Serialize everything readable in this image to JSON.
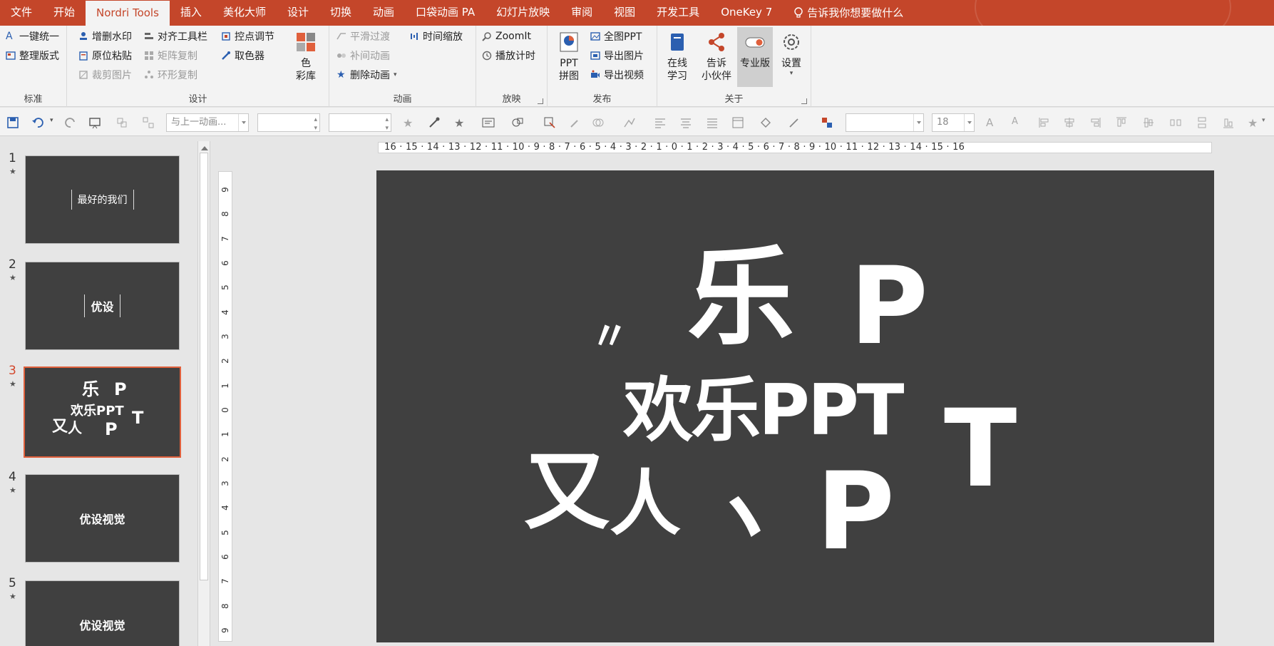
{
  "tabs": [
    "文件",
    "开始",
    "Nordri Tools",
    "插入",
    "美化大师",
    "设计",
    "切换",
    "动画",
    "口袋动画 PA",
    "幻灯片放映",
    "审阅",
    "视图",
    "开发工具",
    "OneKey 7"
  ],
  "tell_me": "告诉我你想要做什么",
  "ribbon": {
    "std": {
      "label": "标准",
      "b1": "一键统一",
      "b2": "整理版式"
    },
    "design": {
      "label": "设计",
      "b1": "增删水印",
      "b2": "原位粘贴",
      "b3": "裁剪图片",
      "b4": "对齐工具栏",
      "b5": "矩阵复制",
      "b6": "环形复制",
      "b7": "控点调节",
      "b8": "取色器",
      "b9": "色\n彩库"
    },
    "anim": {
      "label": "动画",
      "b1": "平滑过渡",
      "b2": "补间动画",
      "b3": "删除动画",
      "b4": "时间缩放"
    },
    "show": {
      "label": "放映",
      "b1": "ZoomIt",
      "b2": "播放计时"
    },
    "pub": {
      "label": "发布",
      "b1": "PPT\n拼图",
      "b2": "全图PPT",
      "b3": "导出图片",
      "b4": "导出视频"
    },
    "about": {
      "label": "关于",
      "b1": "在线\n学习",
      "b2": "告诉\n小伙伴",
      "b3": "专业版",
      "b4": "设置"
    }
  },
  "qtb": {
    "anim_select": "与上一动画...",
    "font_size": "18"
  },
  "hruler_ticks": "16 · 15 · 14 · 13 · 12 · 11 · 10 · 9 · 8 · 7 · 6 · 5 · 4 · 3 · 2 · 1 · 0 · 1 · 2 · 3 · 4 · 5 · 6 · 7 · 8 · 9 · 10 · 11 · 12 · 13 · 14 · 15 · 16",
  "vruler_ticks": [
    "9",
    "8",
    "7",
    "6",
    "5",
    "4",
    "3",
    "2",
    "1",
    "0",
    "1",
    "2",
    "3",
    "4",
    "5",
    "6",
    "7",
    "8",
    "9"
  ],
  "slides": [
    {
      "num": "1",
      "star": "★",
      "text": "最好的我们"
    },
    {
      "num": "2",
      "star": "★",
      "text": "优设"
    },
    {
      "num": "3",
      "star": "★",
      "text": "欢乐PPT"
    },
    {
      "num": "4",
      "star": "★",
      "text": "优设视觉"
    },
    {
      "num": "5",
      "star": "★",
      "text": "优设视觉"
    }
  ],
  "slide_main": {
    "title": "欢乐PPT",
    "pieces": [
      "乐",
      "P",
      "T",
      "P",
      "又",
      "人"
    ]
  }
}
